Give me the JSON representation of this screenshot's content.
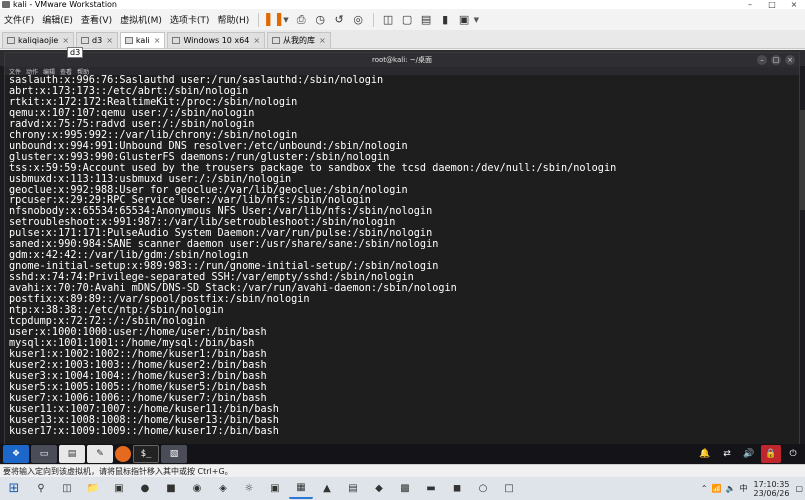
{
  "window": {
    "title": "kali - VMware Workstation"
  },
  "menu": [
    "文件(F)",
    "编辑(E)",
    "查看(V)",
    "虚拟机(M)",
    "选项卡(T)",
    "帮助(H)"
  ],
  "tabs": [
    {
      "label": "kaliqiaojie"
    },
    {
      "label": "d3"
    },
    {
      "label": "kali"
    },
    {
      "label": "Windows 10 x64"
    },
    {
      "label": "从我的库"
    }
  ],
  "tab_tooltip": "d3",
  "terminal": {
    "title": "root@kali: ~/桌面",
    "menu": [
      "文件",
      "动作",
      "编辑",
      "查看",
      "帮助"
    ],
    "lines": [
      "saslauth:x:996:76:Saslauthd user:/run/saslauthd:/sbin/nologin",
      "abrt:x:173:173::/etc/abrt:/sbin/nologin",
      "rtkit:x:172:172:RealtimeKit:/proc:/sbin/nologin",
      "qemu:x:107:107:qemu user:/:/sbin/nologin",
      "radvd:x:75:75:radvd user:/:/sbin/nologin",
      "chrony:x:995:992::/var/lib/chrony:/sbin/nologin",
      "unbound:x:994:991:Unbound DNS resolver:/etc/unbound:/sbin/nologin",
      "gluster:x:993:990:GlusterFS daemons:/run/gluster:/sbin/nologin",
      "tss:x:59:59:Account used by the trousers package to sandbox the tcsd daemon:/dev/null:/sbin/nologin",
      "usbmuxd:x:113:113:usbmuxd user:/:/sbin/nologin",
      "geoclue:x:992:988:User for geoclue:/var/lib/geoclue:/sbin/nologin",
      "rpcuser:x:29:29:RPC Service User:/var/lib/nfs:/sbin/nologin",
      "nfsnobody:x:65534:65534:Anonymous NFS User:/var/lib/nfs:/sbin/nologin",
      "setroubleshoot:x:991:987::/var/lib/setroubleshoot:/sbin/nologin",
      "pulse:x:171:171:PulseAudio System Daemon:/var/run/pulse:/sbin/nologin",
      "saned:x:990:984:SANE scanner daemon user:/usr/share/sane:/sbin/nologin",
      "gdm:x:42:42::/var/lib/gdm:/sbin/nologin",
      "gnome-initial-setup:x:989:983::/run/gnome-initial-setup/:/sbin/nologin",
      "sshd:x:74:74:Privilege-separated SSH:/var/empty/sshd:/sbin/nologin",
      "avahi:x:70:70:Avahi mDNS/DNS-SD Stack:/var/run/avahi-daemon:/sbin/nologin",
      "postfix:x:89:89::/var/spool/postfix:/sbin/nologin",
      "ntp:x:38:38::/etc/ntp:/sbin/nologin",
      "tcpdump:x:72:72::/:/sbin/nologin",
      "user:x:1000:1000:user:/home/user:/bin/bash",
      "mysql:x:1001:1001::/home/mysql:/bin/bash",
      "kuser1:x:1002:1002::/home/kuser1:/bin/bash",
      "kuser2:x:1003:1003::/home/kuser2:/bin/bash",
      "kuser3:x:1004:1004::/home/kuser3:/bin/bash",
      "kuser5:x:1005:1005::/home/kuser5:/bin/bash",
      "kuser7:x:1006:1006::/home/kuser7:/bin/bash",
      "kuser11:x:1007:1007::/home/kuser11:/bin/bash",
      "kuser13:x:1008:1008::/home/kuser13:/bin/bash",
      "kuser17:x:1009:1009::/home/kuser17:/bin/bash"
    ]
  },
  "dock": {
    "terminal_label": "$_"
  },
  "status_bar": "要将输入定向到该虚拟机，请将鼠标指针移入其中或按 Ctrl+G。",
  "taskbar": {
    "tray": {
      "ime": "中",
      "wifi": "📶"
    },
    "time": "17:10:35",
    "date": "23/06/26"
  }
}
